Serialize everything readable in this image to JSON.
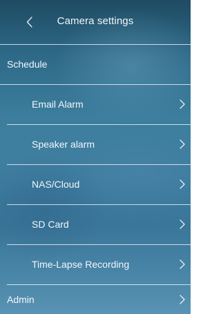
{
  "header": {
    "title": "Camera settings",
    "back_icon": "chevron-left-icon"
  },
  "menu": {
    "schedule_label": "Schedule",
    "email_alarm_label": "Email Alarm",
    "speaker_alarm_label": "Speaker alarm",
    "nas_cloud_label": "NAS/Cloud",
    "sd_card_label": "SD Card",
    "time_lapse_label": "Time-Lapse Recording",
    "admin_label": "Admin"
  },
  "colors": {
    "background_top": "#1f4b63",
    "background_bottom": "#5a93b3",
    "text": "#ffffff",
    "divider": "#ffffff"
  }
}
